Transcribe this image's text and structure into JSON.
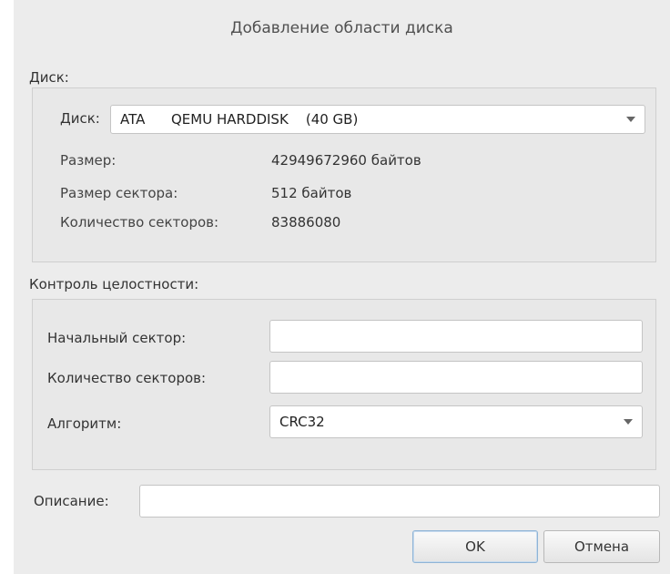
{
  "window": {
    "title": "Добавление области диска"
  },
  "disk_section": {
    "label": "Диск:",
    "disk_label": "Диск:",
    "disk_selected": "ATA      QEMU HARDDISK    (40 GB)",
    "rows": [
      {
        "label": "Размер:",
        "value": "42949672960 байтов"
      },
      {
        "label": "Размер сектора:",
        "value": "512 байтов"
      },
      {
        "label": "Количество секторов:",
        "value": "83886080"
      }
    ]
  },
  "integrity_section": {
    "label": "Контроль целостности:",
    "start_sector_label": "Начальный сектор:",
    "start_sector_value": "",
    "sector_count_label": "Количество секторов:",
    "sector_count_value": "",
    "algorithm_label": "Алгоритм:",
    "algorithm_selected": "CRC32"
  },
  "description": {
    "label": "Описание:",
    "value": ""
  },
  "buttons": {
    "ok": "OK",
    "cancel": "Отмена"
  }
}
